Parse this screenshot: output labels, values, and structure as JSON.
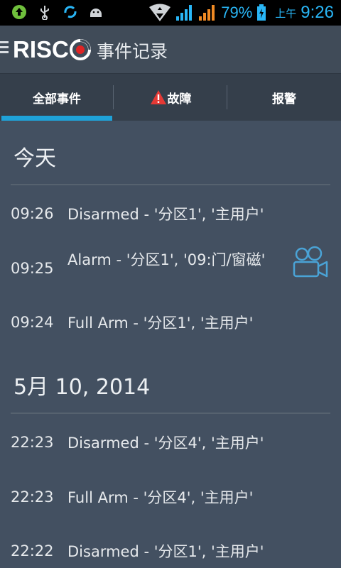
{
  "status_bar": {
    "battery": "79%",
    "ampm": "上午",
    "time": "9:26",
    "icons": [
      "upload-icon",
      "usb-icon",
      "sync-icon",
      "android-icon",
      "wifi-icon",
      "signal-icon",
      "signal-icon",
      "battery-icon"
    ],
    "accent_color": "#29b6f6"
  },
  "app_bar": {
    "logo_text": "RISC",
    "title": "事件记录"
  },
  "tabs": [
    {
      "label": "全部事件",
      "active": true
    },
    {
      "label": "故障",
      "icon": "warning-icon"
    },
    {
      "label": "报警"
    }
  ],
  "sections": [
    {
      "title": "今天",
      "events": [
        {
          "time": "09:26",
          "text": "Disarmed - '分区1', '主用户'"
        },
        {
          "time": "09:25",
          "text": "Alarm - '分区1', '09:门/窗磁'",
          "icon": "video-camera-icon"
        },
        {
          "time": "09:24",
          "text": "Full Arm - '分区1', '主用户'"
        }
      ]
    },
    {
      "title": "5月 10, 2014",
      "events": [
        {
          "time": "22:23",
          "text": "Disarmed - '分区4', '主用户'"
        },
        {
          "time": "22:23",
          "text": "Full Arm - '分区4', '主用户'"
        },
        {
          "time": "22:22",
          "text": "Disarmed - '分区1', '主用户'"
        }
      ]
    }
  ],
  "colors": {
    "background": "#435061",
    "tab_indicator": "#1fa2d8",
    "camera_icon": "#4aa3d6",
    "warning": "#e53935"
  }
}
